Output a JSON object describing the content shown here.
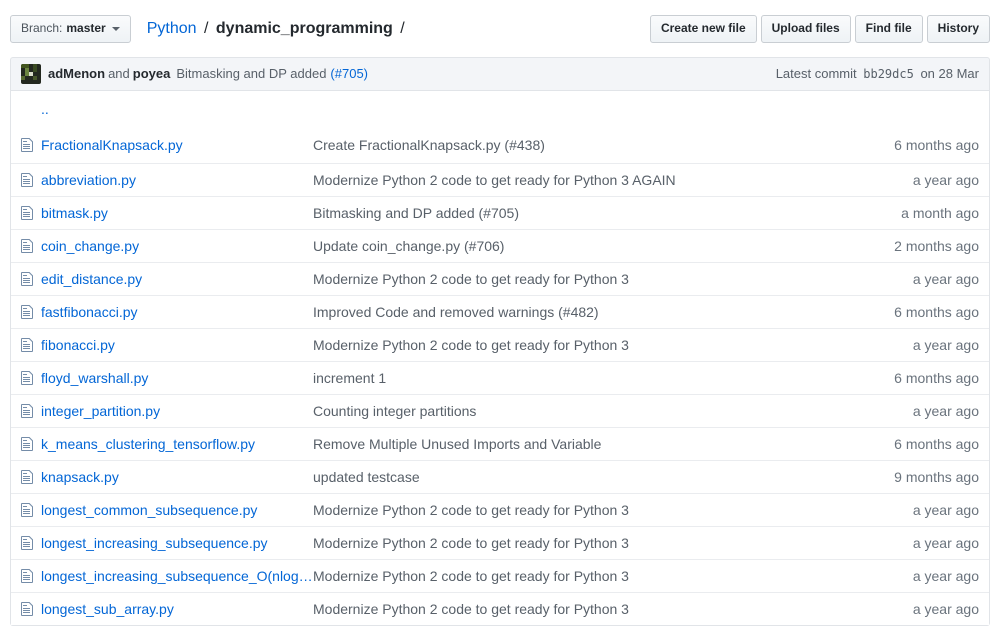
{
  "header": {
    "branch": {
      "label": "Branch:",
      "name": "master"
    },
    "breadcrumb": {
      "root": "Python",
      "separator": "/",
      "current": "dynamic_programming"
    },
    "buttons": [
      "Create new file",
      "Upload files",
      "Find file",
      "History"
    ]
  },
  "commit": {
    "author": "adMenon",
    "and_text": "and",
    "coauthor": "poyea",
    "message": "Bitmasking and DP added",
    "pr": "(#705)",
    "latest_label": "Latest commit",
    "sha": "bb29dc5",
    "date": "on 28 Mar"
  },
  "parent_dir": "..",
  "files": [
    {
      "name": "FractionalKnapsack.py",
      "message": "Create FractionalKnapsack.py (#438)",
      "age": "6 months ago"
    },
    {
      "name": "abbreviation.py",
      "message": "Modernize Python 2 code to get ready for Python 3 AGAIN",
      "age": "a year ago"
    },
    {
      "name": "bitmask.py",
      "message": "Bitmasking and DP added (#705)",
      "age": "a month ago"
    },
    {
      "name": "coin_change.py",
      "message": "Update coin_change.py (#706)",
      "age": "2 months ago"
    },
    {
      "name": "edit_distance.py",
      "message": "Modernize Python 2 code to get ready for Python 3",
      "age": "a year ago"
    },
    {
      "name": "fastfibonacci.py",
      "message": "Improved Code and removed warnings (#482)",
      "age": "6 months ago"
    },
    {
      "name": "fibonacci.py",
      "message": "Modernize Python 2 code to get ready for Python 3",
      "age": "a year ago"
    },
    {
      "name": "floyd_warshall.py",
      "message": "increment 1",
      "age": "6 months ago"
    },
    {
      "name": "integer_partition.py",
      "message": "Counting integer partitions",
      "age": "a year ago"
    },
    {
      "name": "k_means_clustering_tensorflow.py",
      "message": "Remove Multiple Unused Imports and Variable",
      "age": "6 months ago"
    },
    {
      "name": "knapsack.py",
      "message": "updated testcase",
      "age": "9 months ago"
    },
    {
      "name": "longest_common_subsequence.py",
      "message": "Modernize Python 2 code to get ready for Python 3",
      "age": "a year ago"
    },
    {
      "name": "longest_increasing_subsequence.py",
      "message": "Modernize Python 2 code to get ready for Python 3",
      "age": "a year ago"
    },
    {
      "name": "longest_increasing_subsequence_O(nlog…",
      "message": "Modernize Python 2 code to get ready for Python 3",
      "age": "a year ago"
    },
    {
      "name": "longest_sub_array.py",
      "message": "Modernize Python 2 code to get ready for Python 3",
      "age": "a year ago"
    }
  ],
  "icons": {
    "file": "file-text-icon",
    "caret": "caret-down-icon",
    "avatar": "user-avatar"
  },
  "colors": {
    "link": "#0366d6",
    "text": "#24292e",
    "muted": "#586069",
    "border": "#e1e4e8",
    "row_border": "#eaecef",
    "tease_bg": "#f3f5f8",
    "file_icon": "#748ca8"
  }
}
